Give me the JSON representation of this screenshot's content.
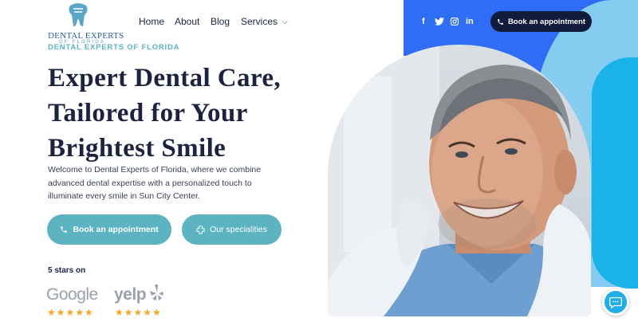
{
  "logo": {
    "name": "DENTAL EXPERTS",
    "subname": "OF FLORIDA",
    "icon": "tooth-icon"
  },
  "brand": {
    "tagline": "DENTAL EXPERTS OF FLORIDA"
  },
  "nav": {
    "items": [
      "Home",
      "About",
      "Blog",
      "Services"
    ]
  },
  "social": {
    "facebook": "f",
    "twitter": "twitter-icon",
    "instagram": "instagram-icon",
    "linkedin": "in"
  },
  "header_cta": {
    "label": "Book an appointment",
    "icon": "phone-icon"
  },
  "hero": {
    "headline_lines": [
      "Expert Dental Care,",
      "Tailored for Your",
      "Brightest Smile"
    ],
    "lead": "Welcome to Dental Experts of Florida, where we combine advanced dental expertise with a personalized touch to illuminate every smile in Sun City Center.",
    "primary_button": "Book an appointment",
    "secondary_button": "Our specialities"
  },
  "ratings": {
    "label": "5 stars on",
    "platforms": [
      {
        "name": "Google",
        "stars": "★★★★★",
        "rating": 5
      },
      {
        "name": "yelp",
        "stars": "★★★★★",
        "rating": 5
      }
    ]
  },
  "colors": {
    "teal": "#5cb3c2",
    "navy": "#111b3d",
    "blue": "#2f6df6",
    "cyan": "#19b3ea",
    "star": "#f5a623"
  },
  "chat": {
    "icon": "chat-icon"
  }
}
